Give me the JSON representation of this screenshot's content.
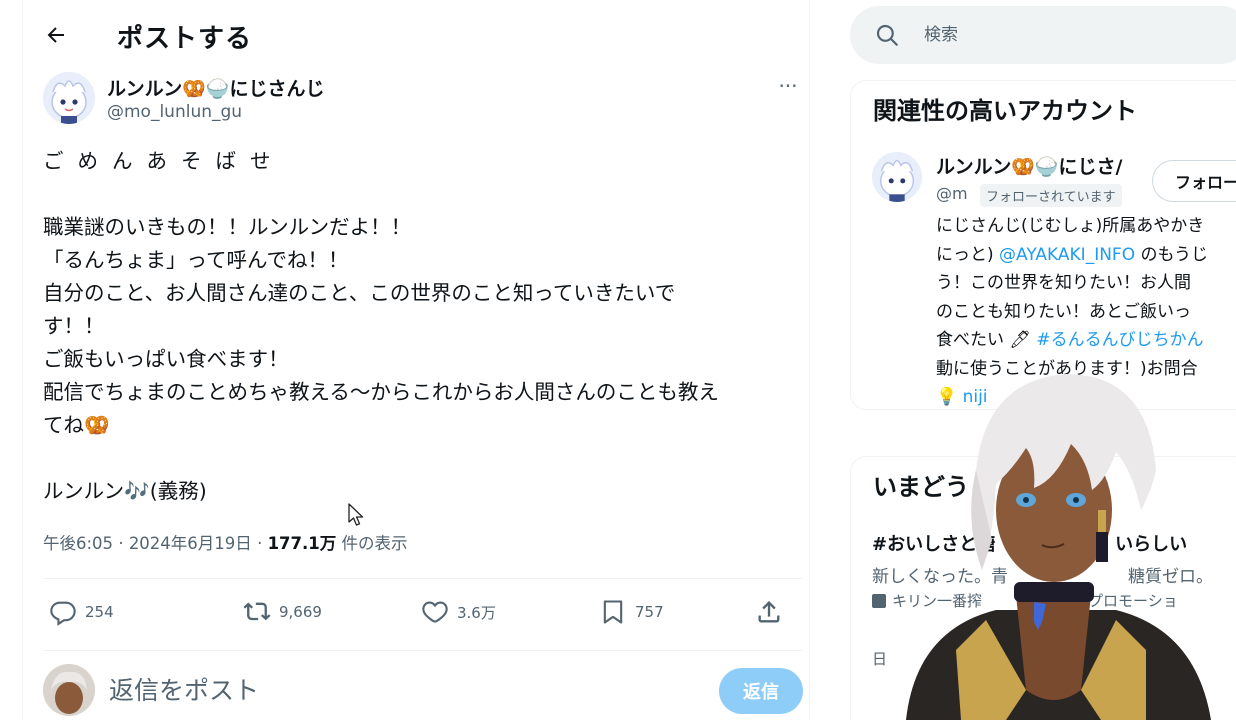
{
  "header": {
    "back_label": "戻る",
    "title": "ポストする"
  },
  "post": {
    "display_name": "ルンルン🥨🍚にじさんじ",
    "handle": "@mo_lunlun_gu",
    "lines": [
      "ごめんあそばせ",
      "",
      "職業謎のいきもの！！ルンルンだよ！！",
      "「るんちょま」って呼んでね！！",
      "自分のこと、お人間さん達のこと、この世界のこと知っていきたいで",
      "す！！",
      "ご飯もいっぱい食べます！",
      "配信でちょまのことめちゃ教える〜からこれからお人間さんのことも教え",
      "てね🥨",
      "",
      "ルンルン🎶(義務)"
    ],
    "meta": {
      "time": "午後6:05",
      "date": "2024年6月19日",
      "views_count": "177.1万",
      "views_label": "件の表示"
    },
    "actions": {
      "replies": "254",
      "reposts": "9,669",
      "likes": "3.6万",
      "bookmarks": "757"
    }
  },
  "reply": {
    "placeholder": "返信をポスト",
    "button_label": "返信"
  },
  "sidebar": {
    "search_placeholder": "検索",
    "relevant": {
      "title": "関連性の高いアカウント",
      "account": {
        "name": "ルンルン🥨🍚にじさ/",
        "handle": "@m",
        "follows_you": "フォローされています",
        "follow_label": "フォロー",
        "bio_lines": [
          {
            "text": "にじさんじ(じむしょ)所属あやかき"
          },
          {
            "pre": "にっと) ",
            "link": "@AYAKAKI_INFO",
            "post": " のもうじ"
          },
          {
            "text": "う！この世界を知りたい！お人間"
          },
          {
            "text": "のことも知りたい！あとご飯いっ"
          },
          {
            "pre": "食べたい 🖊 ",
            "link": "#るんるんびじちかん"
          },
          {
            "text": "動に使うことがあります！)お問合"
          },
          {
            "pre": "💡 ",
            "link": "niji",
            "post": ""
          }
        ]
      }
    },
    "trends": {
      "title": "いまどう",
      "item_tag": "#おいしさと糖",
      "item_tag_tail": "いらしい",
      "item_desc": "新しくなった。青",
      "item_desc_tail": "糖質ゼロ。",
      "item_promo": "キリン一番搾",
      "item_promo_tail": "プロモーショ",
      "partial_line": "日"
    }
  },
  "colors": {
    "accent": "#1d9bf0",
    "reply_button": "#8ecdf8",
    "muted": "#536471",
    "text": "#0f1419"
  }
}
